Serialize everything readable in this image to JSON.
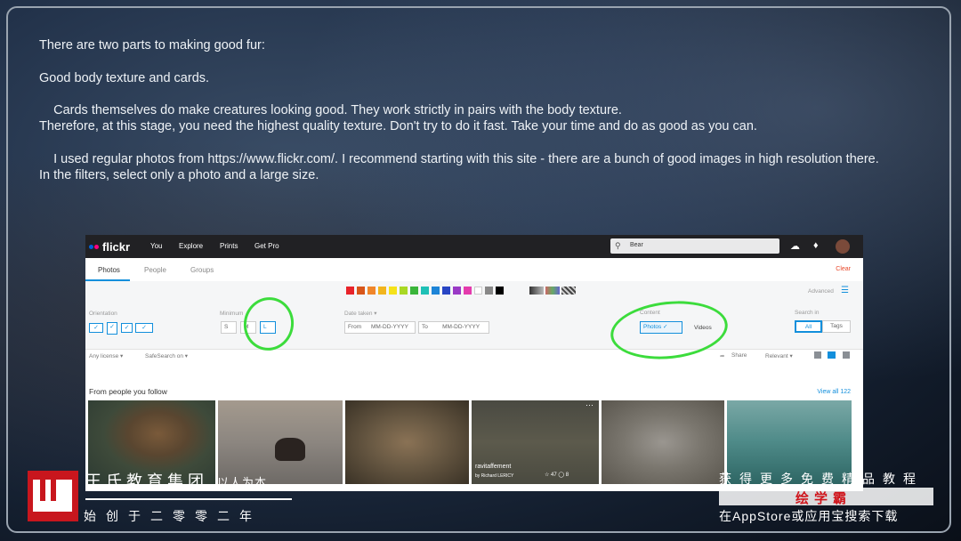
{
  "slide": {
    "line1": "There are two parts to making good fur:",
    "line2": "Good body texture and cards.",
    "line3": "    Cards themselves do make creatures looking good. They work strictly in pairs with the body texture.",
    "line4": "Therefore, at this stage, you need the highest quality texture. Don't try to do it fast. Take your time and do as good as you can.",
    "line5": "    I used regular photos from https://www.flickr.com/. I recommend starting with this site - there are a bunch of good images in high resolution there.",
    "line6": "In the filters, select only a photo and a large size."
  },
  "flickr": {
    "logo": "flickr",
    "nav": [
      "You",
      "Explore",
      "Prints",
      "Get Pro"
    ],
    "search_value": "Bear",
    "tabs": [
      "Photos",
      "People",
      "Groups"
    ],
    "clear": "Clear",
    "advanced": "Advanced",
    "orientation_label": "Orientation",
    "minimum_label": "Minimum",
    "size_options": [
      "S",
      "M",
      "L"
    ],
    "date_label": "Date taken ▾",
    "from_label": "From",
    "from_placeholder": "MM-DD-YYYY",
    "to_label": "To",
    "to_placeholder": "MM-DD-YYYY",
    "content_label": "Content",
    "content_photos": "Photos ✓",
    "content_videos": "Videos",
    "search_in_label": "Search in",
    "search_in_all": "All",
    "search_in_tags": "Tags",
    "license": "Any license ▾",
    "safesearch": "SafeSearch on ▾",
    "share": "Share",
    "relevant": "Relevant ▾",
    "section_title": "From people you follow",
    "view_all": "View all 122",
    "photo_caption_title": "ravitaffement",
    "photo_caption_by": "by Richard LERICY",
    "photo_stats": "☆ 47 ◯ 8",
    "swatch_colors": [
      "#e8232a",
      "#d8561a",
      "#f0862a",
      "#f2b51d",
      "#f5e21a",
      "#a9d824",
      "#3ab53a",
      "#1ec0b6",
      "#1d84d7",
      "#2946c4",
      "#9a3ac6",
      "#e43bad",
      "#ffffff",
      "#888888",
      "#000000"
    ]
  },
  "branding": {
    "name_cn": "王氏教育集团",
    "slogan_cn": "以人为本",
    "founded_cn": "始创于二零零二年",
    "right_line1": "获得更多免费精品教程",
    "right_line2": "绘学霸",
    "right_line3": "在AppStore或应用宝搜索下载"
  }
}
